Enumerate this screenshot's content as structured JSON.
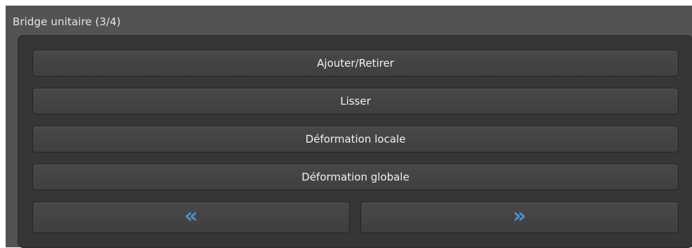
{
  "panel": {
    "title": "Bridge unitaire (3/4)"
  },
  "buttons": {
    "add_remove": "Ajouter/Retirer",
    "smooth": "Lisser",
    "local_deform": "Déformation locale",
    "global_deform": "Déformation globale"
  },
  "navigation": {
    "prev_glyph": "«",
    "next_glyph": "»",
    "prev_icon": "double-chevron-left-icon",
    "next_icon": "double-chevron-right-icon"
  },
  "colors": {
    "panel_bg": "#535353",
    "group_bg": "#363636",
    "button_bg": "#444444",
    "arrow_accent": "#4f8fd6",
    "text": "#f2f2f2"
  }
}
